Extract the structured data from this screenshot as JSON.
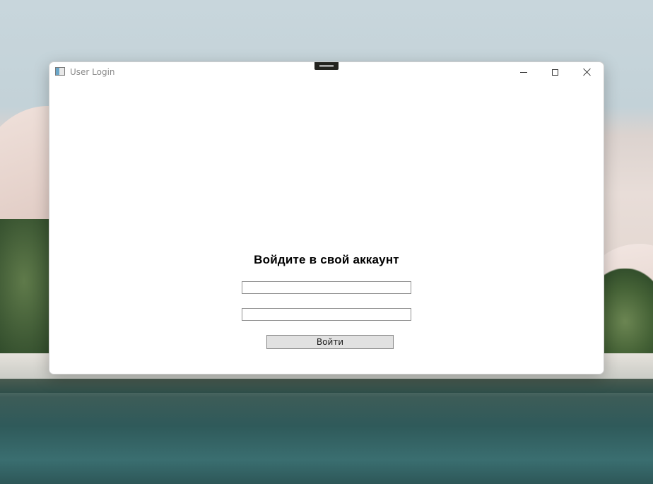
{
  "window": {
    "title": "User Login",
    "caption_buttons": {
      "minimize_icon": "minimize-icon",
      "maximize_icon": "maximize-icon",
      "close_icon": "close-icon"
    }
  },
  "form": {
    "heading": "Войдите в свой аккаунт",
    "login_field": {
      "value": "",
      "placeholder": ""
    },
    "password_field": {
      "value": "",
      "placeholder": ""
    },
    "submit_label": "Войти"
  },
  "colors": {
    "window_background": "#ffffff",
    "button_background": "#e1e1e1",
    "field_border": "#8f8f8f"
  }
}
